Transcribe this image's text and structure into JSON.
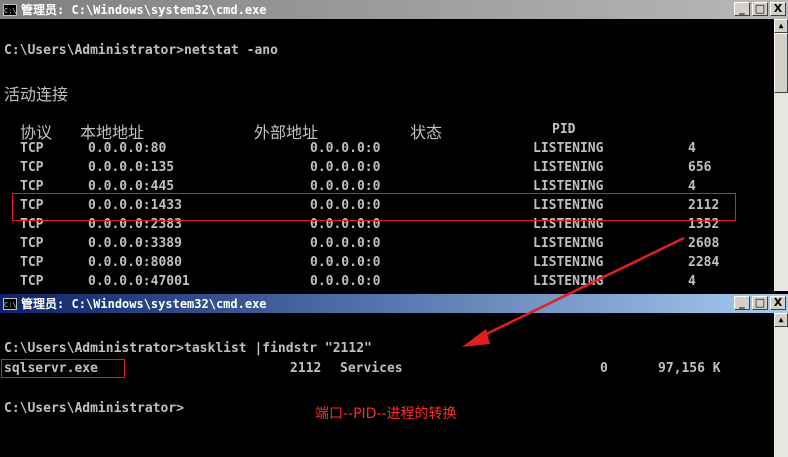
{
  "window1": {
    "title_prefix": "管理员",
    "title_path": ": C:\\Windows\\system32\\cmd.exe",
    "buttons": [
      "_",
      "□",
      "X"
    ],
    "command_line": "C:\\Users\\Administrator>netstat -ano",
    "section_title": "活动连接",
    "headers": {
      "proto": "协议",
      "local": "本地地址",
      "foreign": "外部地址",
      "state": "状态",
      "pid": "PID"
    },
    "rows": [
      {
        "proto": "TCP",
        "local": "0.0.0.0:80",
        "foreign": "0.0.0.0:0",
        "state": "LISTENING",
        "pid": "4"
      },
      {
        "proto": "TCP",
        "local": "0.0.0.0:135",
        "foreign": "0.0.0.0:0",
        "state": "LISTENING",
        "pid": "656"
      },
      {
        "proto": "TCP",
        "local": "0.0.0.0:445",
        "foreign": "0.0.0.0:0",
        "state": "LISTENING",
        "pid": "4"
      },
      {
        "proto": "TCP",
        "local": "0.0.0.0:1433",
        "foreign": "0.0.0.0:0",
        "state": "LISTENING",
        "pid": "2112"
      },
      {
        "proto": "TCP",
        "local": "0.0.0.0:2383",
        "foreign": "0.0.0.0:0",
        "state": "LISTENING",
        "pid": "1352"
      },
      {
        "proto": "TCP",
        "local": "0.0.0.0:3389",
        "foreign": "0.0.0.0:0",
        "state": "LISTENING",
        "pid": "2608"
      },
      {
        "proto": "TCP",
        "local": "0.0.0.0:8080",
        "foreign": "0.0.0.0:0",
        "state": "LISTENING",
        "pid": "2284"
      },
      {
        "proto": "TCP",
        "local": "0.0.0.0:47001",
        "foreign": "0.0.0.0:0",
        "state": "LISTENING",
        "pid": "4"
      }
    ]
  },
  "window2": {
    "title_prefix": "管理员",
    "title_path": ": C:\\Windows\\system32\\cmd.exe",
    "buttons": [
      "_",
      "□",
      "X"
    ],
    "command_line": "C:\\Users\\Administrator>tasklist |findstr \"2112\"",
    "result": {
      "image": "sqlservr.exe",
      "pid": "2112",
      "session": "Services",
      "session_num": "0",
      "mem": "97,156 K"
    },
    "prompt": "C:\\Users\\Administrator>",
    "annotation": "端口--PID--进程的转换"
  },
  "colors": {
    "console_bg": "#000000",
    "console_text": "#c0c0c0",
    "highlight": "#e02020",
    "annotation": "#ff2a2a"
  }
}
